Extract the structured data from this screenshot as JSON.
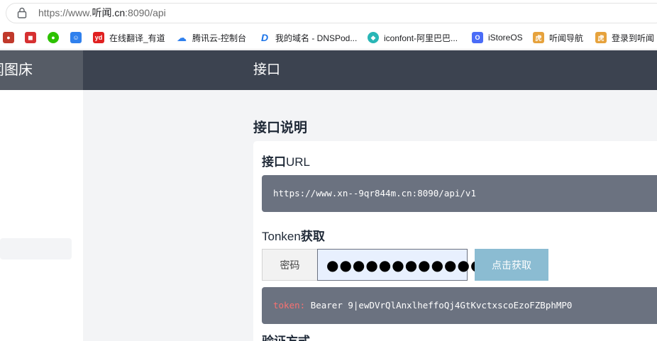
{
  "browser": {
    "url_prefix": "https://www.",
    "url_domain": "听闻.cn",
    "url_suffix": ":8090/api",
    "bookmarks": [
      {
        "label": "",
        "icon": "ninja-icon",
        "color": "#c0392b"
      },
      {
        "label": "",
        "icon": "app-red-icon",
        "color": "#d63031"
      },
      {
        "label": "",
        "icon": "wechat-icon",
        "color": "#2dc100"
      },
      {
        "label": "",
        "icon": "user-icon",
        "color": "#2f80ed"
      },
      {
        "label": "在线翻译_有道",
        "icon": "youdao-icon",
        "color": "#e02020"
      },
      {
        "label": "腾讯云-控制台",
        "icon": "cloud-icon",
        "color": "#2f80ed"
      },
      {
        "label": "我的域名 - DNSPod...",
        "icon": "dnspod-icon",
        "color": "#1a73e8"
      },
      {
        "label": "iconfont-阿里巴巴...",
        "icon": "iconfont-icon",
        "color": "#29b6b6"
      },
      {
        "label": "iStoreOS",
        "icon": "istore-icon",
        "color": "#4a6cf7"
      },
      {
        "label": "听闻导航",
        "icon": "tiger-icon",
        "color": "#e6a23c"
      },
      {
        "label": "登录到听闻",
        "icon": "tiger-icon-2",
        "color": "#e6a23c"
      }
    ]
  },
  "header": {
    "brand": "闻图床",
    "title": "接口"
  },
  "main": {
    "section_title": "接口说明",
    "url_heading_bold": "接口",
    "url_heading_rest": "URL",
    "api_url": "https://www.xn--9qr844m.cn:8090/api/v1",
    "token_heading_rest": "Tonken",
    "token_heading_bold": "获取",
    "password_label": "密码",
    "password_value": "●●●●●●●●●●●●",
    "get_button": "点击获取",
    "token_key": "token:",
    "token_value": "Bearer 9|ewDVrQlAnxlheffoQj4GtKvctxscoEzoFZBphMP0",
    "next_heading": "验证方式"
  }
}
